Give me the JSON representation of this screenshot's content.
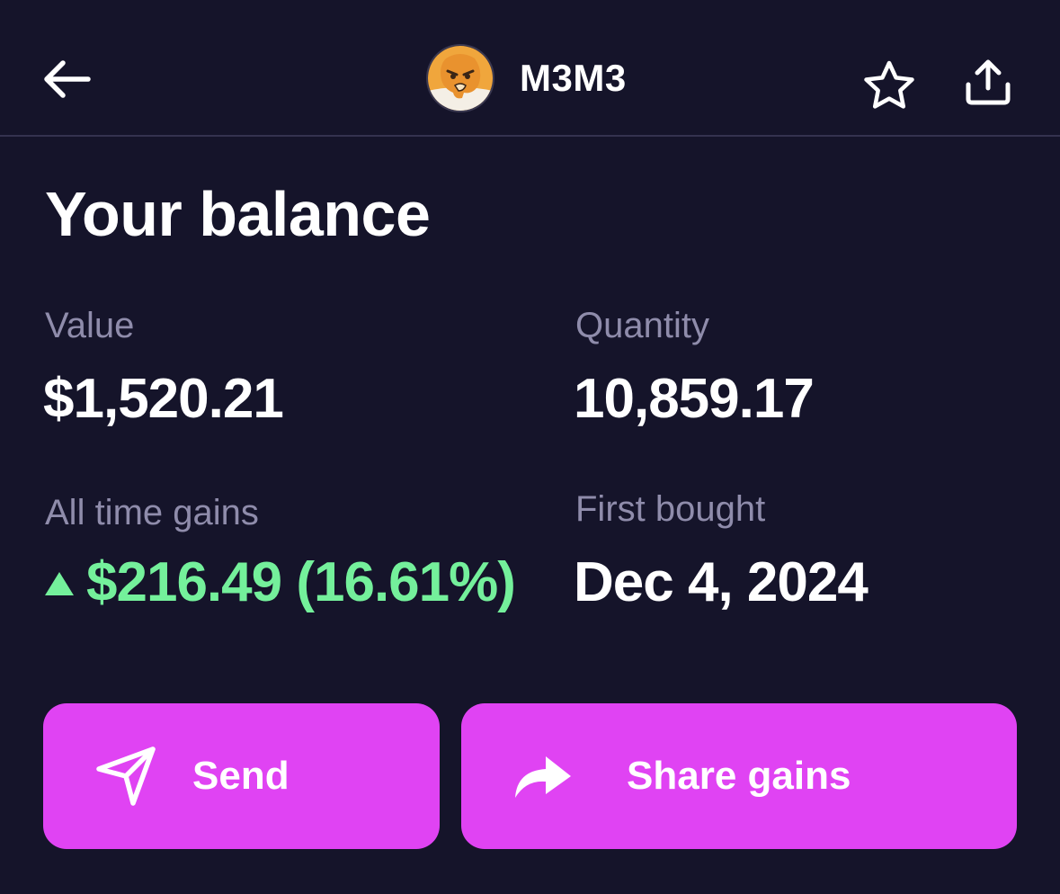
{
  "header": {
    "token_name": "M3M3",
    "icons": {
      "back": "arrow-left-icon",
      "favorite": "star-outline-icon",
      "share": "share-upload-icon"
    }
  },
  "balance": {
    "title": "Your balance",
    "value_label": "Value",
    "value": "$1,520.21",
    "quantity_label": "Quantity",
    "quantity": "10,859.17",
    "gains_label": "All time gains",
    "gains": "$216.49 (16.61%)",
    "first_bought_label": "First bought",
    "first_bought": "Dec 4, 2024"
  },
  "actions": {
    "send_label": "Send",
    "share_gains_label": "Share gains"
  },
  "colors": {
    "background": "#15142a",
    "accent": "#e043f3",
    "positive": "#74f09b",
    "muted_text": "#8f8cab",
    "divider": "#34324f"
  }
}
